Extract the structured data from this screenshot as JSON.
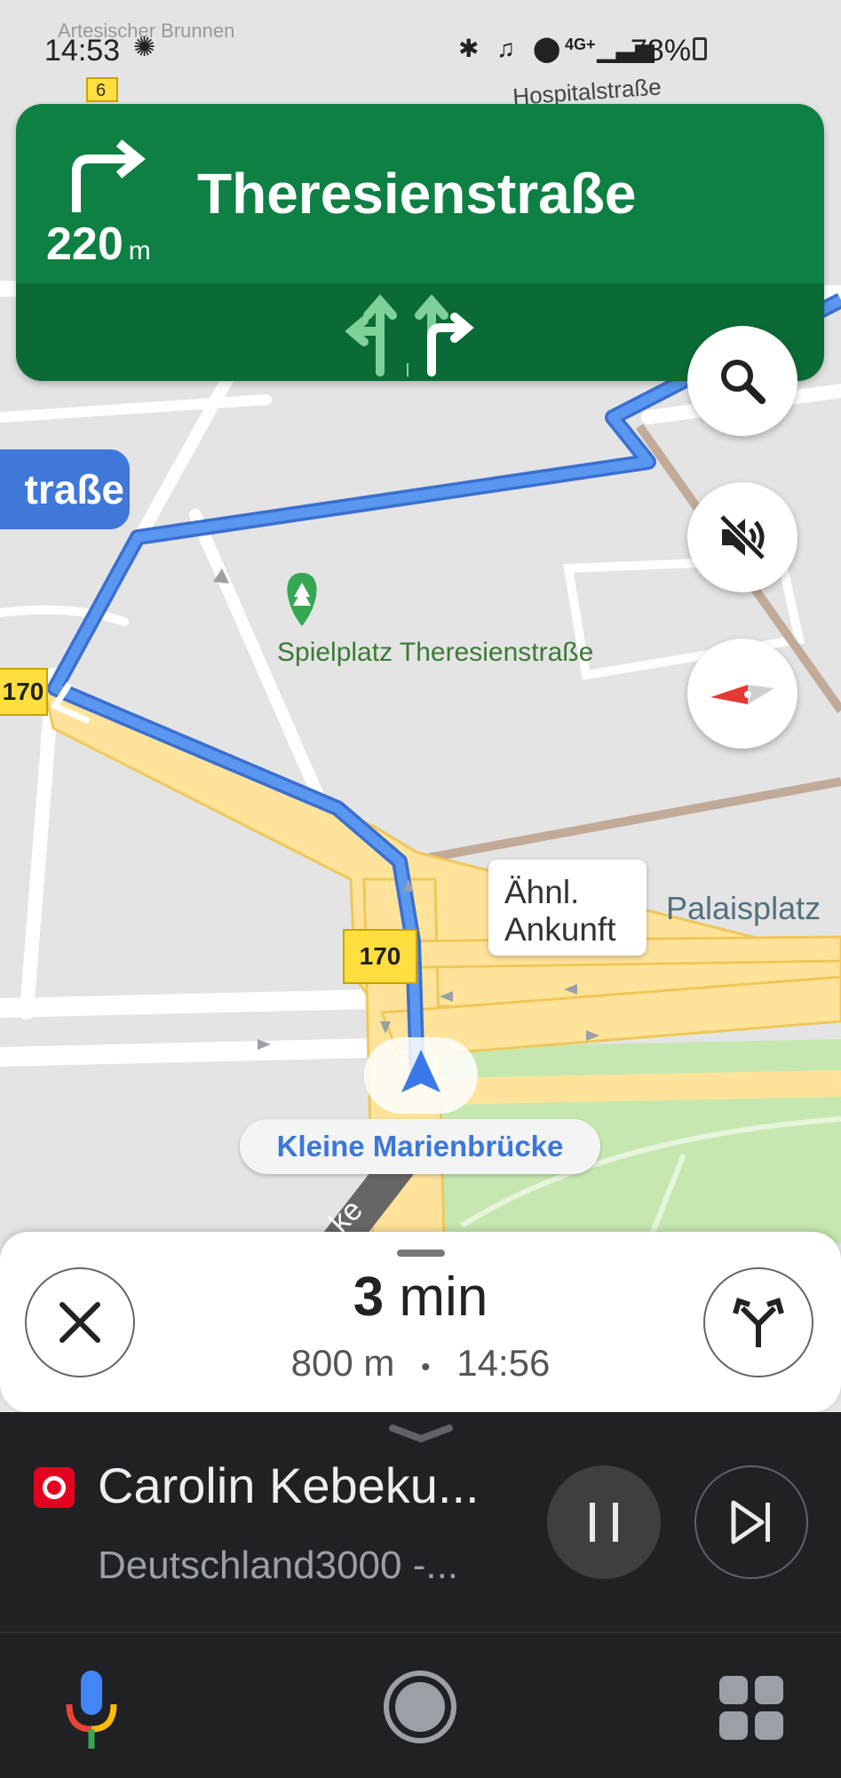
{
  "status_bar": {
    "time": "14:53",
    "battery": "78%",
    "network": "4G+"
  },
  "map_labels": {
    "top_faded_1": "Artesischer Brunnen",
    "top_faded_2": "Hospitalstraße",
    "blue_street_tag": "traße",
    "poi_name": "Spielplatz Theresienstraße",
    "route_callout": "Ähnl.\nAnkunft",
    "palaisplatz": "Palaisplatz",
    "route_shield_left": "170",
    "route_shield_center": "170",
    "shield_top_1": "6",
    "current_street": "Kleine Marienbrücke",
    "road_fragment": "ke"
  },
  "navigation": {
    "next_street": "Theresienstraße",
    "distance_value": "220",
    "distance_unit": "m",
    "maneuver": "turn-right",
    "lanes": [
      "left-straight",
      "straight-right"
    ]
  },
  "trip": {
    "eta_minutes": "3",
    "eta_unit": "min",
    "distance": "800 m",
    "separator": "•",
    "arrival_time": "14:56"
  },
  "media": {
    "track": "Carolin Kebeku...",
    "artist": "Deutschland3000 -...",
    "app_icon": "podcast-app-icon"
  },
  "colors": {
    "nav_green": "#0e8043",
    "nav_green_dark": "#0b6b36",
    "route_blue": "#4a86e8",
    "media_bg": "#202124"
  }
}
